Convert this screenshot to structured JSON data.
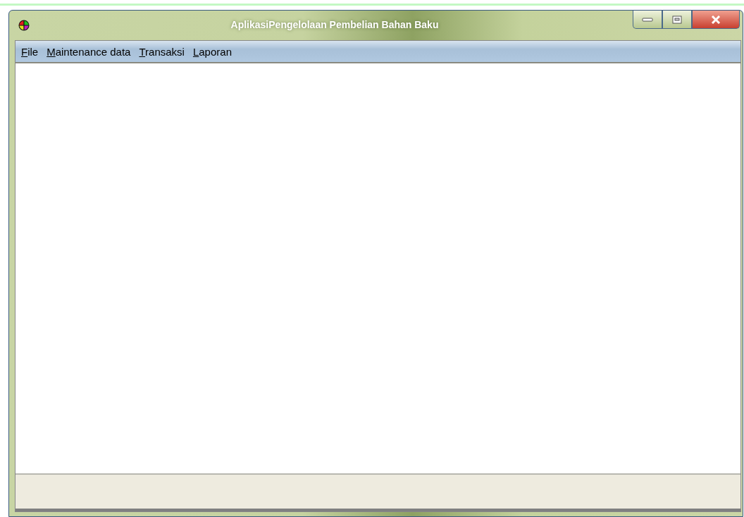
{
  "window": {
    "title": "AplikasiPengelolaan Pembelian Bahan Baku"
  },
  "menu": [
    {
      "label": "File",
      "underline_first": true
    },
    {
      "label": "Maintenance data",
      "underline_first": true
    },
    {
      "label": "Transaksi",
      "underline_first": true
    },
    {
      "label": "Laporan",
      "underline_first": true
    }
  ]
}
